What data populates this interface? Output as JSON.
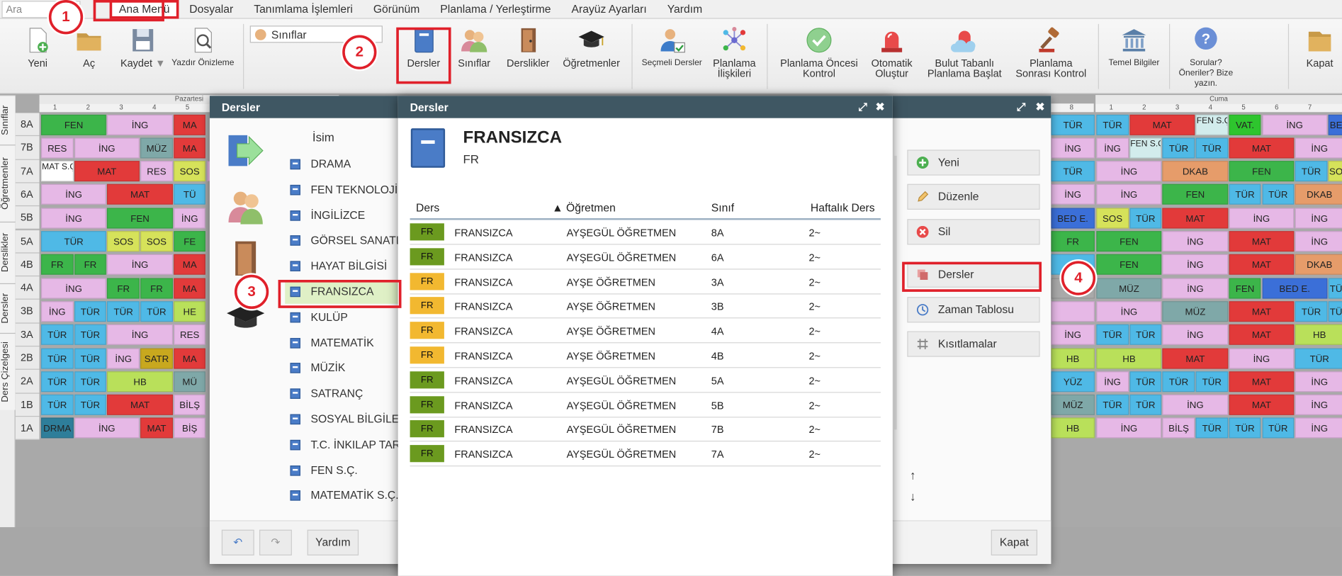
{
  "menubar": {
    "search_placeholder": "Ara",
    "items": [
      "Ana Menü",
      "Dosyalar",
      "Tanımlama İşlemleri",
      "Görünüm",
      "Planlama / Yerleştirme",
      "Arayüz Ayarları",
      "Yardım"
    ]
  },
  "ribbon": {
    "yeni": "Yeni",
    "ac": "Aç",
    "kaydet": "Kaydet",
    "yazdir": "Yazdır Önizleme",
    "class_dropdown": "Sınıflar",
    "dersler": "Dersler",
    "siniflar": "Sınıflar",
    "derslikler": "Derslikler",
    "ogretmenler": "Öğretmenler",
    "secmeli": "Seçmeli Dersler",
    "planlama_iliskileri_1": "Planlama",
    "planlama_iliskileri_2": "İlişkileri",
    "oncesi_1": "Planlama Öncesi",
    "oncesi_2": "Kontrol",
    "otomatik_1": "Otomatik",
    "otomatik_2": "Oluştur",
    "bulut_1": "Bulut Tabanlı",
    "bulut_2": "Planlama Başlat",
    "sonrasi_1": "Planlama",
    "sonrasi_2": "Sonrası Kontrol",
    "temel": "Temel Bilgiler",
    "sorular_1": "Sorular?",
    "sorular_2": "Öneriler? Bize",
    "sorular_3": "yazın.",
    "kapat": "Kapat"
  },
  "steps": [
    "1",
    "2",
    "3",
    "4"
  ],
  "sidetabs": [
    "Sınıflar",
    "Öğretmenler",
    "Derslikler",
    "Dersler",
    "Ders Çizelgesi"
  ],
  "grid": {
    "day_left": "Pazartesi",
    "day_right": "Cuma",
    "rows": [
      "8A",
      "7B",
      "7A",
      "6A",
      "5B",
      "5A",
      "4B",
      "4A",
      "3B",
      "3A",
      "2B",
      "2A",
      "1B",
      "1A"
    ],
    "col_nums": [
      "1",
      "2",
      "3",
      "4",
      "5"
    ],
    "col_nums_right": [
      "1",
      "2",
      "3",
      "4",
      "5",
      "6",
      "7"
    ],
    "mid_col_num": "8",
    "left_cells": [
      [
        [
          "FEN",
          "#3cb54a",
          2
        ],
        [
          "İNG",
          "#e6b8e6",
          2
        ],
        [
          "MA",
          "#e23a3a",
          1
        ]
      ],
      [
        [
          "RES",
          "#e6b8e6",
          1
        ],
        [
          "İNG",
          "#e6b8e6",
          2
        ],
        [
          "MÜZ",
          "#7fa8a8",
          1
        ],
        [
          "MA",
          "#e23a3a",
          1
        ]
      ],
      [
        [
          "MAT S.Ç.",
          "#ffffff",
          1
        ],
        [
          "MAT",
          "#e23a3a",
          2
        ],
        [
          "RES",
          "#e6b8e6",
          1
        ],
        [
          "SOS",
          "#d6e25a",
          1
        ],
        [
          "",
          "#e6b8e6",
          0.3
        ]
      ],
      [
        [
          "İNG",
          "#e6b8e6",
          2
        ],
        [
          "MAT",
          "#e23a3a",
          2
        ],
        [
          "TÜ",
          "#4fb9e6",
          1
        ]
      ],
      [
        [
          "İNG",
          "#e6b8e6",
          2
        ],
        [
          "FEN",
          "#3cb54a",
          2
        ],
        [
          "İNG",
          "#e6b8e6",
          1
        ]
      ],
      [
        [
          "TÜR",
          "#4fb9e6",
          2
        ],
        [
          "SOS",
          "#d6e25a",
          1
        ],
        [
          "SOS",
          "#d6e25a",
          1
        ],
        [
          "FE",
          "#3cb54a",
          1
        ]
      ],
      [
        [
          "FR",
          "#3cb54a",
          1
        ],
        [
          "FR",
          "#3cb54a",
          1
        ],
        [
          "İNG",
          "#e6b8e6",
          2
        ],
        [
          "MA",
          "#e23a3a",
          1
        ]
      ],
      [
        [
          "İNG",
          "#e6b8e6",
          2
        ],
        [
          "FR",
          "#3cb54a",
          1
        ],
        [
          "FR",
          "#3cb54a",
          1
        ],
        [
          "MA",
          "#e23a3a",
          1
        ]
      ],
      [
        [
          "İNG",
          "#e6b8e6",
          1
        ],
        [
          "TÜR",
          "#4fb9e6",
          1
        ],
        [
          "TÜR",
          "#4fb9e6",
          1
        ],
        [
          "TÜR",
          "#4fb9e6",
          1
        ],
        [
          "HE",
          "#b9e05a",
          1
        ]
      ],
      [
        [
          "TÜR",
          "#4fb9e6",
          1
        ],
        [
          "TÜR",
          "#4fb9e6",
          1
        ],
        [
          "İNG",
          "#e6b8e6",
          2
        ],
        [
          "RES",
          "#e6b8e6",
          1
        ]
      ],
      [
        [
          "TÜR",
          "#4fb9e6",
          1
        ],
        [
          "TÜR",
          "#4fb9e6",
          1
        ],
        [
          "İNG",
          "#e6b8e6",
          1
        ],
        [
          "SATR",
          "#c8a81e",
          1
        ],
        [
          "MA",
          "#e23a3a",
          1
        ]
      ],
      [
        [
          "TÜR",
          "#4fb9e6",
          1
        ],
        [
          "TÜR",
          "#4fb9e6",
          1
        ],
        [
          "HB",
          "#b9e05a",
          2
        ],
        [
          "MÜ",
          "#7fa8a8",
          1
        ]
      ],
      [
        [
          "TÜR",
          "#4fb9e6",
          1
        ],
        [
          "TÜR",
          "#4fb9e6",
          1
        ],
        [
          "MAT",
          "#e23a3a",
          2
        ],
        [
          "BİLŞ",
          "#e6b8e6",
          1
        ]
      ],
      [
        [
          "DRMA",
          "#2e7e9a",
          1
        ],
        [
          "İNG",
          "#e6b8e6",
          2
        ],
        [
          "MAT",
          "#e23a3a",
          1
        ],
        [
          "BİŞ",
          "#e6b8e6",
          1
        ]
      ]
    ],
    "mid_cells": [
      [
        [
          "TÜR",
          "#4fb9e6",
          1
        ]
      ],
      [
        [
          "İNG",
          "#e6b8e6",
          1
        ]
      ],
      [
        [
          "TÜR",
          "#4fb9e6",
          1
        ]
      ],
      [
        [
          "İNG",
          "#e6b8e6",
          1
        ]
      ],
      [
        [
          "BED E.",
          "#3b6fd8",
          1
        ]
      ],
      [
        [
          "FR",
          "#3cb54a",
          1
        ]
      ],
      [
        [
          "",
          "#4fb9e6",
          1
        ]
      ],
      [
        [
          "",
          "#a9a9a9",
          1
        ]
      ],
      [
        [
          "",
          "#e6b8e6",
          1
        ]
      ],
      [
        [
          "İNG",
          "#e6b8e6",
          1
        ]
      ],
      [
        [
          "HB",
          "#b9e05a",
          1
        ]
      ],
      [
        [
          "YÜZ",
          "#4fb9e6",
          1
        ]
      ],
      [
        [
          "MÜZ",
          "#7fa8a8",
          1
        ]
      ],
      [
        [
          "HB",
          "#b9e05a",
          1
        ]
      ]
    ],
    "right_cells": [
      [
        [
          "TÜR",
          "#4fb9e6",
          1
        ],
        [
          "MAT",
          "#e23a3a",
          2
        ],
        [
          "FEN S.Ç.",
          "#d2ecec",
          1
        ],
        [
          "VAT.",
          "#2ec52e",
          1
        ],
        [
          "İNG",
          "#e6b8e6",
          2
        ],
        [
          "BE",
          "#3b6fd8",
          0.5
        ]
      ],
      [
        [
          "İNG",
          "#e6b8e6",
          1
        ],
        [
          "FEN S.Ç.",
          "#d2ecec",
          1
        ],
        [
          "TÜR",
          "#4fb9e6",
          1
        ],
        [
          "TÜR",
          "#4fb9e6",
          1
        ],
        [
          "MAT",
          "#e23a3a",
          2
        ],
        [
          "İNG",
          "#e6b8e6",
          1.5
        ]
      ],
      [
        [
          "İNG",
          "#e6b8e6",
          2
        ],
        [
          "DKAB",
          "#e69c6a",
          2
        ],
        [
          "FEN",
          "#3cb54a",
          2
        ],
        [
          "TÜR",
          "#4fb9e6",
          1
        ],
        [
          "SO",
          "#d6e25a",
          0.5
        ]
      ],
      [
        [
          "İNG",
          "#e6b8e6",
          2
        ],
        [
          "FEN",
          "#3cb54a",
          2
        ],
        [
          "TÜR",
          "#4fb9e6",
          1
        ],
        [
          "TÜR",
          "#4fb9e6",
          1
        ],
        [
          "DKAB",
          "#e69c6a",
          1.5
        ]
      ],
      [
        [
          "SOS",
          "#d6e25a",
          1
        ],
        [
          "TÜR",
          "#4fb9e6",
          1
        ],
        [
          "MAT",
          "#e23a3a",
          2
        ],
        [
          "İNG",
          "#e6b8e6",
          2
        ],
        [
          "İNG",
          "#e6b8e6",
          1.5
        ]
      ],
      [
        [
          "FEN",
          "#3cb54a",
          2
        ],
        [
          "İNG",
          "#e6b8e6",
          2
        ],
        [
          "MAT",
          "#e23a3a",
          2
        ],
        [
          "İNG",
          "#e6b8e6",
          1.5
        ]
      ],
      [
        [
          "FEN",
          "#3cb54a",
          2
        ],
        [
          "İNG",
          "#e6b8e6",
          2
        ],
        [
          "MAT",
          "#e23a3a",
          2
        ],
        [
          "DKAB",
          "#e69c6a",
          1.5
        ]
      ],
      [
        [
          "MÜZ",
          "#7fa8a8",
          2
        ],
        [
          "İNG",
          "#e6b8e6",
          2
        ],
        [
          "FEN",
          "#3cb54a",
          1
        ],
        [
          "BED E.",
          "#3b6fd8",
          2
        ],
        [
          "TÜ",
          "#4fb9e6",
          0.5
        ]
      ],
      [
        [
          "İNG",
          "#e6b8e6",
          2
        ],
        [
          "MÜZ",
          "#7fa8a8",
          2
        ],
        [
          "MAT",
          "#e23a3a",
          2
        ],
        [
          "TÜR",
          "#4fb9e6",
          1
        ],
        [
          "TÜ",
          "#4fb9e6",
          0.5
        ]
      ],
      [
        [
          "TÜR",
          "#4fb9e6",
          1
        ],
        [
          "TÜR",
          "#4fb9e6",
          1
        ],
        [
          "İNG",
          "#e6b8e6",
          2
        ],
        [
          "MAT",
          "#e23a3a",
          2
        ],
        [
          "HB",
          "#b9e05a",
          1.5
        ]
      ],
      [
        [
          "HB",
          "#b9e05a",
          2
        ],
        [
          "MAT",
          "#e23a3a",
          2
        ],
        [
          "İNG",
          "#e6b8e6",
          2
        ],
        [
          "TÜR",
          "#4fb9e6",
          1.5
        ]
      ],
      [
        [
          "İNG",
          "#e6b8e6",
          1
        ],
        [
          "TÜR",
          "#4fb9e6",
          1
        ],
        [
          "TÜR",
          "#4fb9e6",
          1
        ],
        [
          "TÜR",
          "#4fb9e6",
          1
        ],
        [
          "MAT",
          "#e23a3a",
          2
        ],
        [
          "İNG",
          "#e6b8e6",
          1.5
        ]
      ],
      [
        [
          "TÜR",
          "#4fb9e6",
          1
        ],
        [
          "TÜR",
          "#4fb9e6",
          1
        ],
        [
          "İNG",
          "#e6b8e6",
          2
        ],
        [
          "MAT",
          "#e23a3a",
          2
        ],
        [
          "İNG",
          "#e6b8e6",
          1.5
        ]
      ],
      [
        [
          "İNG",
          "#e6b8e6",
          2
        ],
        [
          "BİLŞ",
          "#e6b8e6",
          1
        ],
        [
          "TÜR",
          "#4fb9e6",
          1
        ],
        [
          "TÜR",
          "#4fb9e6",
          1
        ],
        [
          "TÜR",
          "#4fb9e6",
          1
        ],
        [
          "İNG",
          "#e6b8e6",
          1.5
        ]
      ]
    ]
  },
  "dialog1": {
    "title": "Dersler",
    "list_header": "İsim",
    "items": [
      "DRAMA",
      "FEN TEKNOLOJİ",
      "İNGİLİZCE",
      "GÖRSEL SANATLAR",
      "HAYAT BİLGİSİ",
      "FRANSIZCA",
      "KULÜP",
      "MATEMATİK",
      "MÜZİK",
      "SATRANÇ",
      "SOSYAL BİLGİLER",
      "T.C. İNKILAP TARİHİ",
      "FEN S.Ç.",
      "MATEMATİK S.Ç."
    ],
    "actions": [
      "Yeni",
      "Düzenle",
      "Sil",
      "Dersler",
      "Zaman Tablosu",
      "Kısıtlamalar"
    ],
    "help": "Yardım",
    "close": "Kapat",
    "up": "↑",
    "down": "↓"
  },
  "dialog2": {
    "title": "Dersler",
    "course_name": "FRANSIZCA",
    "course_code": "FR",
    "columns": [
      "Ders",
      "▲ Öğretmen",
      "Sınıf",
      "Haftalık Ders"
    ],
    "rows": [
      {
        "badge": "FR",
        "color": "#6b9a1f",
        "ders": "FRANSIZCA",
        "ogretmen": "AYŞEGÜL ÖĞRETMEN",
        "sinif": "8A",
        "saat": "2~"
      },
      {
        "badge": "FR",
        "color": "#6b9a1f",
        "ders": "FRANSIZCA",
        "ogretmen": "AYŞEGÜL ÖĞRETMEN",
        "sinif": "6A",
        "saat": "2~"
      },
      {
        "badge": "FR",
        "color": "#f2b830",
        "ders": "FRANSIZCA",
        "ogretmen": "AYŞE ÖĞRETMEN",
        "sinif": "3A",
        "saat": "2~"
      },
      {
        "badge": "FR",
        "color": "#f2b830",
        "ders": "FRANSIZCA",
        "ogretmen": "AYŞE ÖĞRETMEN",
        "sinif": "3B",
        "saat": "2~"
      },
      {
        "badge": "FR",
        "color": "#f2b830",
        "ders": "FRANSIZCA",
        "ogretmen": "AYŞE ÖĞRETMEN",
        "sinif": "4A",
        "saat": "2~"
      },
      {
        "badge": "FR",
        "color": "#f2b830",
        "ders": "FRANSIZCA",
        "ogretmen": "AYŞE ÖĞRETMEN",
        "sinif": "4B",
        "saat": "2~"
      },
      {
        "badge": "FR",
        "color": "#6b9a1f",
        "ders": "FRANSIZCA",
        "ogretmen": "AYŞEGÜL ÖĞRETMEN",
        "sinif": "5A",
        "saat": "2~"
      },
      {
        "badge": "FR",
        "color": "#6b9a1f",
        "ders": "FRANSIZCA",
        "ogretmen": "AYŞEGÜL ÖĞRETMEN",
        "sinif": "5B",
        "saat": "2~"
      },
      {
        "badge": "FR",
        "color": "#6b9a1f",
        "ders": "FRANSIZCA",
        "ogretmen": "AYŞEGÜL ÖĞRETMEN",
        "sinif": "7B",
        "saat": "2~"
      },
      {
        "badge": "FR",
        "color": "#6b9a1f",
        "ders": "FRANSIZCA",
        "ogretmen": "AYŞEGÜL ÖĞRETMEN",
        "sinif": "7A",
        "saat": "2~"
      }
    ]
  },
  "colors": {
    "highlight": "#e0202a",
    "titlebar": "#3f5763",
    "selected_row": "#dff0c6"
  }
}
